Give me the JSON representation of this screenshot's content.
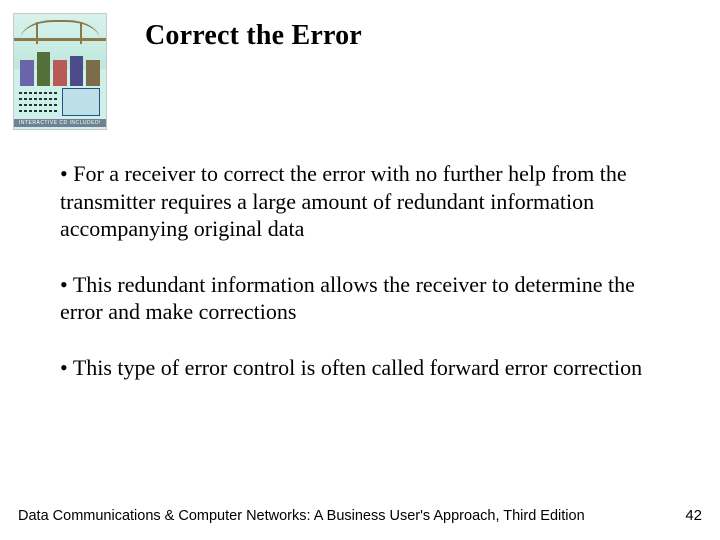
{
  "thumb": {
    "label": "Interactive CD Included!"
  },
  "title": "Correct the Error",
  "bullets": {
    "b1": "For a receiver to correct the error with no further help from the transmitter requires a large amount of redundant information accompanying original data",
    "b2": "This redundant information allows the receiver to determine the error and make corrections",
    "b3": "This type of error control is often called forward error correction"
  },
  "footer": {
    "text": "Data Communications & Computer Networks: A Business User's Approach, Third Edition",
    "page": "42"
  }
}
